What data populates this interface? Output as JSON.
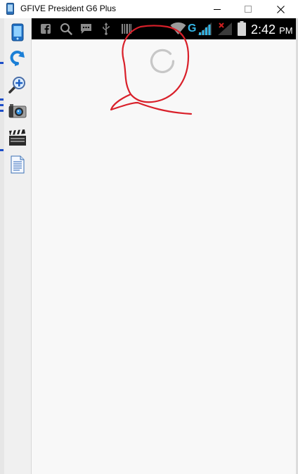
{
  "window": {
    "title": "GFIVE President G6 Plus",
    "controls": {
      "minimize": "minimize",
      "maximize": "maximize",
      "close": "close"
    }
  },
  "toolbar": {
    "tools": [
      {
        "name": "device-icon"
      },
      {
        "name": "rotate-icon"
      },
      {
        "name": "zoom-icon"
      },
      {
        "name": "camera-icon"
      },
      {
        "name": "video-icon"
      },
      {
        "name": "document-icon"
      }
    ]
  },
  "status_bar": {
    "time": "2:42",
    "ampm": "PM",
    "network": "G",
    "icons": [
      "facebook-icon",
      "search-icon",
      "message-icon",
      "usb-icon",
      "barcode-icon",
      "wifi-icon",
      "signal-icon",
      "no-signal-icon",
      "battery-icon"
    ]
  },
  "screen": {
    "state": "loading"
  },
  "colors": {
    "annotation": "#d9202a",
    "status_bar": "#000000",
    "network": "#33b5e5"
  }
}
